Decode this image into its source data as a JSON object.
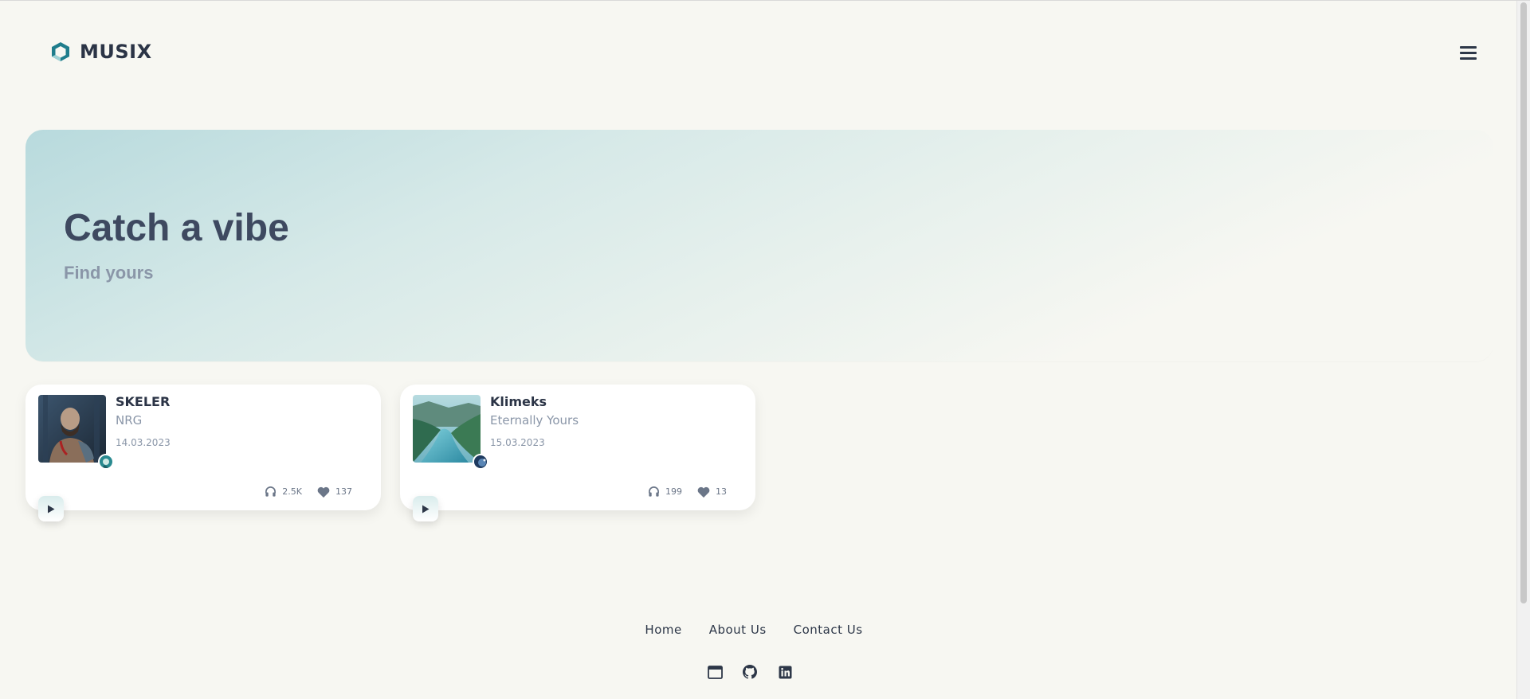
{
  "brand": {
    "name": "MUSIX",
    "accent": "#1f7d8c"
  },
  "hero": {
    "title": "Catch a vibe",
    "subtitle": "Find yours"
  },
  "tracks": [
    {
      "title": "SKELER",
      "artist": "NRG",
      "date": "14.03.2023",
      "plays": "2.5K",
      "likes": "137"
    },
    {
      "title": "Klimeks",
      "artist": "Eternally Yours",
      "date": "15.03.2023",
      "plays": "199",
      "likes": "13"
    }
  ],
  "footer": {
    "links": [
      "Home",
      "About Us",
      "Contact Us"
    ],
    "icons": [
      "browser-window-icon",
      "github-icon",
      "linkedin-icon"
    ]
  },
  "colors": {
    "background": "#f7f7f2",
    "text": "#2d3748",
    "muted": "#8a96a8"
  }
}
